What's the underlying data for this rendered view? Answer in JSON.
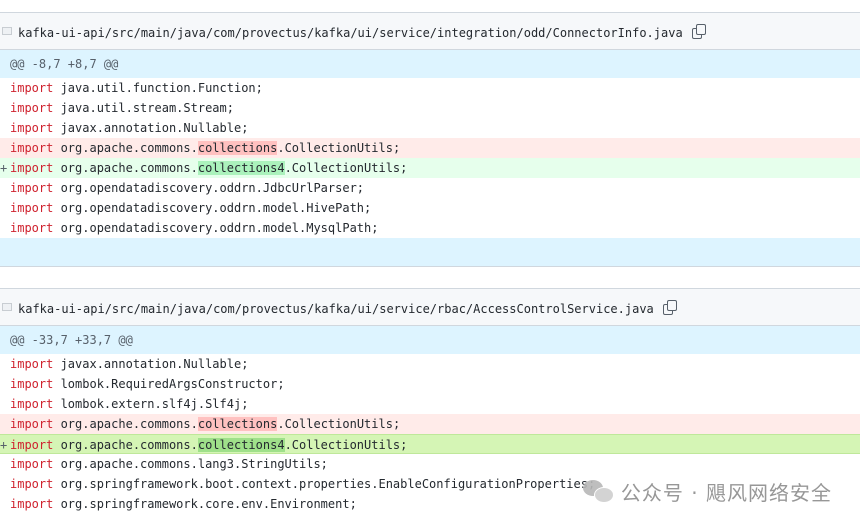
{
  "files": [
    {
      "path": "kafka-ui-api/src/main/java/com/provectus/kafka/ui/service/integration/odd/ConnectorInfo.java",
      "hunk": "@@ -8,7 +8,7 @@",
      "lines": [
        {
          "type": "ctx",
          "kw": "import",
          "before": " java.util.function.Function;",
          "hl": "",
          "after": ""
        },
        {
          "type": "ctx",
          "kw": "import",
          "before": " java.util.stream.Stream;",
          "hl": "",
          "after": ""
        },
        {
          "type": "ctx",
          "kw": "import",
          "before": " javax.annotation.Nullable;",
          "hl": "",
          "after": ""
        },
        {
          "type": "del",
          "kw": "import",
          "before": " org.apache.commons.",
          "hl": "collections",
          "after": ".CollectionUtils;"
        },
        {
          "type": "add",
          "marker": "+",
          "kw": "import",
          "before": " org.apache.commons.",
          "hl": "collections4",
          "after": ".CollectionUtils;"
        },
        {
          "type": "ctx",
          "kw": "import",
          "before": " org.opendatadiscovery.oddrn.JdbcUrlParser;",
          "hl": "",
          "after": ""
        },
        {
          "type": "ctx",
          "kw": "import",
          "before": " org.opendatadiscovery.oddrn.model.HivePath;",
          "hl": "",
          "after": ""
        },
        {
          "type": "ctx",
          "kw": "import",
          "before": " org.opendatadiscovery.oddrn.model.MysqlPath;",
          "hl": "",
          "after": ""
        }
      ]
    },
    {
      "path": "kafka-ui-api/src/main/java/com/provectus/kafka/ui/service/rbac/AccessControlService.java",
      "hunk": "@@ -33,7 +33,7 @@",
      "lines": [
        {
          "type": "ctx",
          "kw": "import",
          "before": " javax.annotation.Nullable;",
          "hl": "",
          "after": ""
        },
        {
          "type": "ctx",
          "kw": "import",
          "before": " lombok.RequiredArgsConstructor;",
          "hl": "",
          "after": ""
        },
        {
          "type": "ctx",
          "kw": "import",
          "before": " lombok.extern.slf4j.Slf4j;",
          "hl": "",
          "after": ""
        },
        {
          "type": "del",
          "kw": "import",
          "before": " org.apache.commons.",
          "hl": "collections",
          "after": ".CollectionUtils;"
        },
        {
          "type": "add2",
          "marker": "+",
          "kw": "import",
          "before": " org.apache.commons.",
          "hl": "collections4",
          "after": ".CollectionUtils;"
        },
        {
          "type": "ctx",
          "kw": "import",
          "before": " org.apache.commons.lang3.StringUtils;",
          "hl": "",
          "after": ""
        },
        {
          "type": "ctx",
          "kw": "import",
          "before": " org.springframework.boot.context.properties.EnableConfigurationProperties;",
          "hl": "",
          "after": ""
        },
        {
          "type": "ctx",
          "kw": "import",
          "before": " org.springframework.core.env.Environment;",
          "hl": "",
          "after": ""
        }
      ]
    }
  ],
  "watermark": {
    "text": "公众号 · 飓风网络安全",
    "icon": "wechat-icon"
  }
}
